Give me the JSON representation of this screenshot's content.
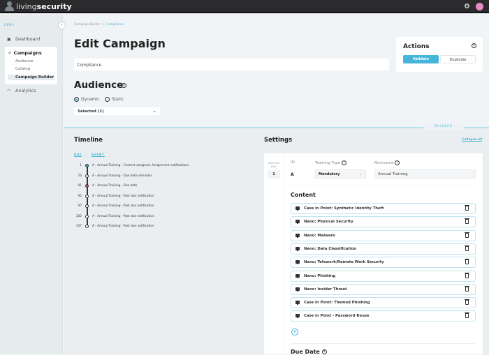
{
  "app": {
    "brand_light": "living",
    "brand_bold": "security"
  },
  "header": {
    "settings_icon": "gear-icon",
    "avatar_icon": "user-avatar"
  },
  "sidebar": {
    "org_label": "DEMO",
    "items": [
      {
        "label": "Dashboard",
        "icon": "dashboard-icon"
      },
      {
        "label": "Campaigns",
        "icon": "campaigns-icon",
        "children": [
          "Audience",
          "Catalog",
          "Campaign Builder"
        ],
        "active_child": "Campaign Builder"
      },
      {
        "label": "Analytics",
        "icon": "analytics-icon"
      }
    ]
  },
  "breadcrumb": {
    "parent": "Campaign Builder",
    "separator": ">",
    "current": "Compliance"
  },
  "page": {
    "title": "Edit Campaign",
    "campaign_name": "Compliance"
  },
  "audience": {
    "title": "Audience",
    "options": [
      "Dynamic",
      "Static"
    ],
    "selected_option": "Dynamic",
    "dropdown_value": "Selected (1)"
  },
  "actions": {
    "title": "Actions",
    "validate_label": "Validate",
    "duplicate_label": "Duplicate"
  },
  "builder_tab": "BUILDER",
  "timeline": {
    "title": "Timeline",
    "col_day": "DAY",
    "col_event": "EVENT",
    "rows": [
      {
        "day": "1",
        "event": "A - Annual Training - Content assigned, Assignment notifications",
        "dot": "#46b5d8"
      },
      {
        "day": "76",
        "event": "A - Annual Training - Due date reminder",
        "dot": "#ffffff"
      },
      {
        "day": "91",
        "event": "A - Annual Training - Due date",
        "dot": "#c0507a"
      },
      {
        "day": "92",
        "event": "A - Annual Training - Past due notification",
        "dot": "#ffffff"
      },
      {
        "day": "97",
        "event": "A - Annual Training - Past due notification",
        "dot": "#ffffff"
      },
      {
        "day": "102",
        "event": "A - Annual Training - Past due notification",
        "dot": "#ffffff"
      },
      {
        "day": "107",
        "event": "A - Annual Training - Past due notification",
        "dot": "#ffffff"
      }
    ]
  },
  "settings": {
    "title": "Settings",
    "collapse_all": "Collapse all",
    "assign_day_label": "ASSIGN DAY",
    "assign_day": "1",
    "id_label": "ID",
    "id_value": "A",
    "training_type_label": "Training Type",
    "training_type": "Mandatory",
    "nickname_label": "Nickname",
    "nickname": "Annual Training",
    "content_title": "Content",
    "content": [
      "Case in Point: Synthetic Identity Theft",
      "Nano: Physical Security",
      "Nano: Malware",
      "Nano: Data Classification",
      "Nano: Telework/Remote Work Security",
      "Nano: Phishing",
      "Nano: Insider Threat",
      "Case in Point: Themed Phishing",
      "Case in Point - Password Reuse"
    ],
    "due_date_title": "Due Date"
  },
  "colors": {
    "accent": "#46b5d8",
    "topbar": "#2b2b2d",
    "avatar": "#e58bc6"
  }
}
